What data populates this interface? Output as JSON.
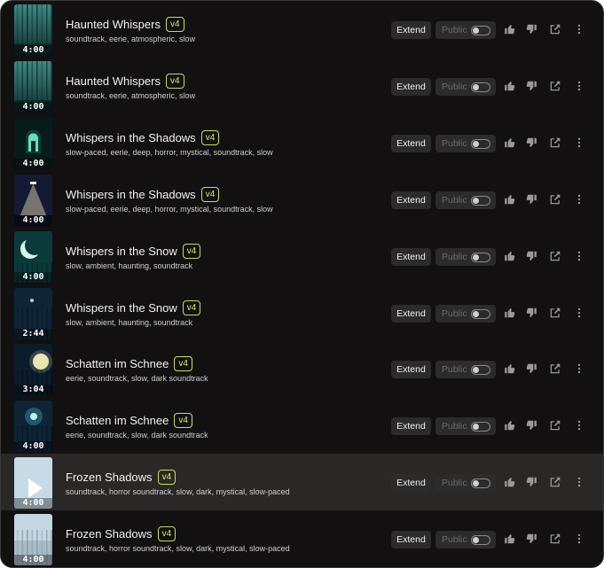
{
  "rows": [
    {
      "title": "Haunted Whispers",
      "version": "v4",
      "tags": "soundtrack, eerie, atmospheric, slow",
      "duration": "4:00",
      "thumb": "forest",
      "selected": false
    },
    {
      "title": "Haunted Whispers",
      "version": "v4",
      "tags": "soundtrack, eerie, atmospheric, slow",
      "duration": "4:00",
      "thumb": "forest",
      "selected": false
    },
    {
      "title": "Whispers in the Shadows",
      "version": "v4",
      "tags": "slow-paced, eerie, deep, horror, mystical, soundtrack, slow",
      "duration": "4:00",
      "thumb": "door",
      "selected": false
    },
    {
      "title": "Whispers in the Shadows",
      "version": "v4",
      "tags": "slow-paced, eerie, deep, horror, mystical, soundtrack, slow",
      "duration": "4:00",
      "thumb": "lamp",
      "selected": false
    },
    {
      "title": "Whispers in the Snow",
      "version": "v4",
      "tags": "slow, ambient, haunting, soundtrack",
      "duration": "4:00",
      "thumb": "crescent",
      "selected": false
    },
    {
      "title": "Whispers in the Snow",
      "version": "v4",
      "tags": "slow, ambient, haunting, soundtrack",
      "duration": "2:44",
      "thumb": "night",
      "selected": false
    },
    {
      "title": "Schatten im Schnee",
      "version": "v4",
      "tags": "eerie, soundtrack, slow, dark soundtrack",
      "duration": "3:04",
      "thumb": "moon",
      "selected": false
    },
    {
      "title": "Schatten im Schnee",
      "version": "v4",
      "tags": "eerie, soundtrack, slow, dark soundtrack",
      "duration": "4:00",
      "thumb": "glow",
      "selected": false
    },
    {
      "title": "Frozen Shadows",
      "version": "v4",
      "tags": "soundtrack, horror soundtrack, slow, dark, mystical, slow-paced",
      "duration": "4:00",
      "thumb": "snow",
      "selected": true
    },
    {
      "title": "Frozen Shadows",
      "version": "v4",
      "tags": "soundtrack, horror soundtrack, slow, dark, mystical, slow-paced",
      "duration": "4:00",
      "thumb": "snow2",
      "selected": false
    }
  ],
  "labels": {
    "extend": "Extend",
    "public": "Public"
  },
  "icons": {
    "like": "thumbs-up-icon",
    "dislike": "thumbs-down-icon",
    "share": "share-icon",
    "more": "more-vertical-icon",
    "play": "play-icon"
  },
  "colors": {
    "badge": "#d8ef5c",
    "background": "#121010"
  }
}
